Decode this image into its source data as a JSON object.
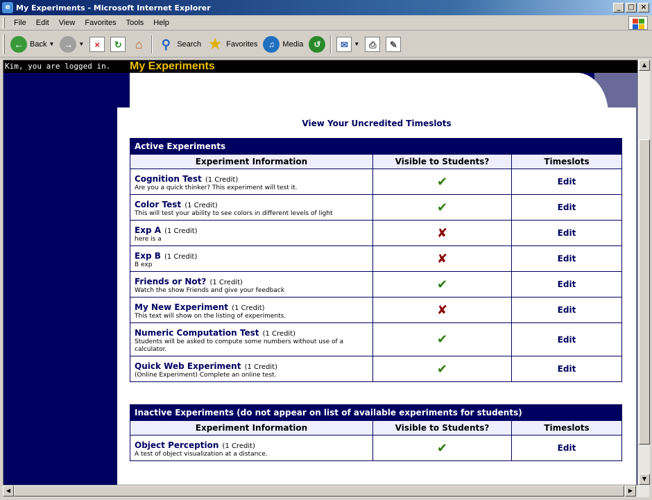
{
  "window": {
    "title": "My Experiments - Microsoft Internet Explorer",
    "minimize": "_",
    "maximize": "□",
    "close": "×"
  },
  "menu": [
    "File",
    "Edit",
    "View",
    "Favorites",
    "Tools",
    "Help"
  ],
  "toolbar": {
    "back": "Back",
    "search": "Search",
    "favorites": "Favorites",
    "media": "Media"
  },
  "page": {
    "logged_in": "Kim, you are logged in.",
    "heading": "My Experiments",
    "uncredited_link": "View Your Uncredited Timeslots"
  },
  "active": {
    "title": "Active Experiments",
    "columns": [
      "Experiment Information",
      "Visible to Students?",
      "Timeslots"
    ],
    "rows": [
      {
        "name": "Cognition Test",
        "credit": "(1 Credit)",
        "desc": "Are you a quick thinker? This experiment will test it.",
        "visible": true,
        "action": "Edit"
      },
      {
        "name": "Color Test",
        "credit": "(1 Credit)",
        "desc": "This will test your ability to see colors in different levels of light",
        "visible": true,
        "action": "Edit"
      },
      {
        "name": "Exp A",
        "credit": "(1 Credit)",
        "desc": "here is a",
        "visible": false,
        "action": "Edit"
      },
      {
        "name": "Exp B",
        "credit": "(1 Credit)",
        "desc": "B exp",
        "visible": false,
        "action": "Edit"
      },
      {
        "name": "Friends or Not?",
        "credit": "(1 Credit)",
        "desc": "Watch the show Friends and give your feedback",
        "visible": true,
        "action": "Edit"
      },
      {
        "name": "My New Experiment",
        "credit": "(1 Credit)",
        "desc": "This text will show on the listing of experiments.",
        "visible": false,
        "action": "Edit"
      },
      {
        "name": "Numeric Computation Test",
        "credit": "(1 Credit)",
        "desc": "Students will be asked to compute some numbers without use of a calculator.",
        "visible": true,
        "action": "Edit"
      },
      {
        "name": "Quick Web Experiment",
        "credit": "(1 Credit)",
        "desc": "(Online Experiment) Complete an online test.",
        "visible": true,
        "action": "Edit"
      }
    ]
  },
  "inactive": {
    "title": "Inactive Experiments (do not appear on list of available experiments for students)",
    "columns": [
      "Experiment Information",
      "Visible to Students?",
      "Timeslots"
    ],
    "rows": [
      {
        "name": "Object Perception",
        "credit": "(1 Credit)",
        "desc": "A test of object visualization at a distance.",
        "visible": true,
        "action": "Edit"
      }
    ]
  },
  "symbols": {
    "check": "✔",
    "cross": "✘"
  },
  "colors": {
    "navy": "#000060",
    "heading_yellow": "#f0c000",
    "check_green": "#2e7d10",
    "cross_red": "#8b0000"
  }
}
